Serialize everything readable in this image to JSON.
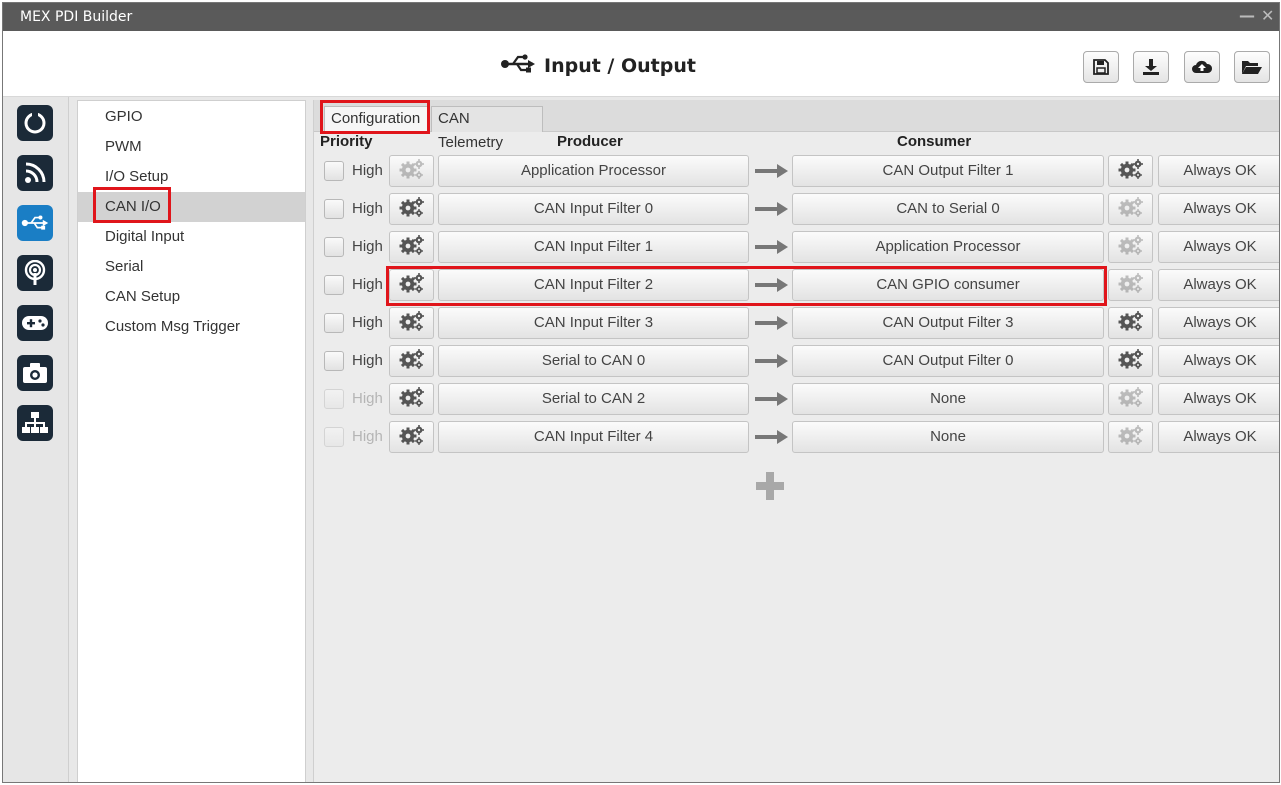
{
  "window": {
    "title": "MEX PDI Builder",
    "minimize": "—",
    "close": "✕"
  },
  "header": {
    "title": "Input / Output",
    "title_icon": "usb-icon",
    "toolbar": [
      {
        "name": "save-icon"
      },
      {
        "name": "download-icon"
      },
      {
        "name": "cloud-upload-icon"
      },
      {
        "name": "folder-open-icon"
      }
    ]
  },
  "iconbar": [
    {
      "name": "power-ring-icon"
    },
    {
      "name": "feed-icon"
    },
    {
      "name": "usb-icon",
      "active": true
    },
    {
      "name": "broadcast-icon"
    },
    {
      "name": "gamepad-icon"
    },
    {
      "name": "camera-icon"
    },
    {
      "name": "sitemap-icon"
    }
  ],
  "menu": {
    "items": [
      {
        "label": "GPIO"
      },
      {
        "label": "PWM"
      },
      {
        "label": "I/O Setup"
      },
      {
        "label": "CAN I/O",
        "selected": true
      },
      {
        "label": "Digital Input"
      },
      {
        "label": "Serial"
      },
      {
        "label": "CAN Setup"
      },
      {
        "label": "Custom Msg Trigger"
      }
    ]
  },
  "tabs": [
    {
      "label": "Configuration",
      "active": true
    },
    {
      "label": "CAN Telemetry",
      "active": false
    }
  ],
  "columns": {
    "priority": "Priority",
    "producer": "Producer",
    "consumer": "Consumer"
  },
  "rows": [
    {
      "priority": "High",
      "producer": "Application Processor",
      "consumer": "CAN Output Filter 1",
      "status": "Always OK",
      "enabled": true,
      "producer_gear": false,
      "consumer_gear": true
    },
    {
      "priority": "High",
      "producer": "CAN Input Filter 0",
      "consumer": "CAN to Serial 0",
      "status": "Always OK",
      "enabled": true,
      "producer_gear": true,
      "consumer_gear": false
    },
    {
      "priority": "High",
      "producer": "CAN Input Filter 1",
      "consumer": "Application Processor",
      "status": "Always OK",
      "enabled": true,
      "producer_gear": true,
      "consumer_gear": false
    },
    {
      "priority": "High",
      "producer": "CAN Input Filter 2",
      "consumer": "CAN GPIO consumer",
      "status": "Always OK",
      "enabled": true,
      "producer_gear": true,
      "consumer_gear": false
    },
    {
      "priority": "High",
      "producer": "CAN Input Filter 3",
      "consumer": "CAN Output Filter 3",
      "status": "Always OK",
      "enabled": true,
      "producer_gear": true,
      "consumer_gear": true
    },
    {
      "priority": "High",
      "producer": "Serial to CAN 0",
      "consumer": "CAN Output Filter 0",
      "status": "Always OK",
      "enabled": true,
      "producer_gear": true,
      "consumer_gear": true
    },
    {
      "priority": "High",
      "producer": "Serial to CAN 2",
      "consumer": "None",
      "status": "Always OK",
      "enabled": false,
      "producer_gear": true,
      "consumer_gear": false
    },
    {
      "priority": "High",
      "producer": "CAN Input Filter 4",
      "consumer": "None",
      "status": "Always OK",
      "enabled": false,
      "producer_gear": true,
      "consumer_gear": false
    }
  ],
  "add_button": {
    "icon": "plus-icon"
  },
  "colors": {
    "highlight": "#e0151b",
    "active_icon": "#1a7ec5",
    "icon_bg": "#1b2a38"
  }
}
